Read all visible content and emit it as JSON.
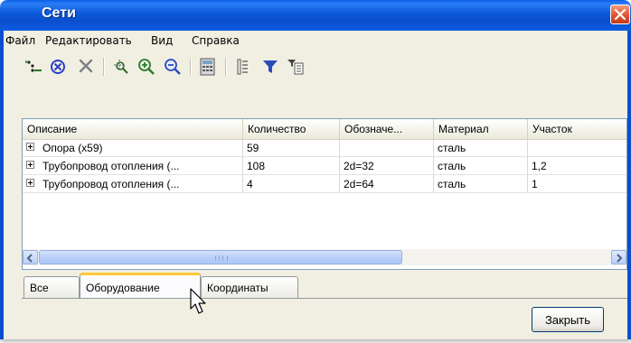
{
  "window": {
    "title": "Сети"
  },
  "menu": [
    "Файл",
    "Редактировать",
    "Вид",
    "Справка"
  ],
  "toolbar": {
    "buttons": [
      "add-points-icon",
      "stop-circle-icon",
      "delete-x-icon",
      "zoom-region-icon",
      "zoom-in-icon",
      "zoom-out-icon",
      "calculator-icon",
      "columns-icon",
      "filter-icon",
      "filter-settings-icon"
    ]
  },
  "table": {
    "columns": [
      "Описание",
      "Количество",
      "Обозначе...",
      "Материал",
      "Участок"
    ],
    "rows": [
      [
        "Опора (x59)",
        "59",
        "",
        "сталь",
        ""
      ],
      [
        "Трубопровод отопления (...",
        "108",
        "2d=32",
        "сталь",
        "1,2"
      ],
      [
        "Трубопровод отопления (...",
        "4",
        "2d=64",
        "сталь",
        "1"
      ]
    ],
    "scroll_grip": "III"
  },
  "tabs": [
    "Все",
    "Оборудование",
    "Координаты"
  ],
  "active_tab": "Оборудование",
  "close_button": "Закрыть",
  "colors": {
    "title_bar": "#0a58d8",
    "close_x": "#e1532e",
    "tab_highlight": "#ffc83c"
  }
}
